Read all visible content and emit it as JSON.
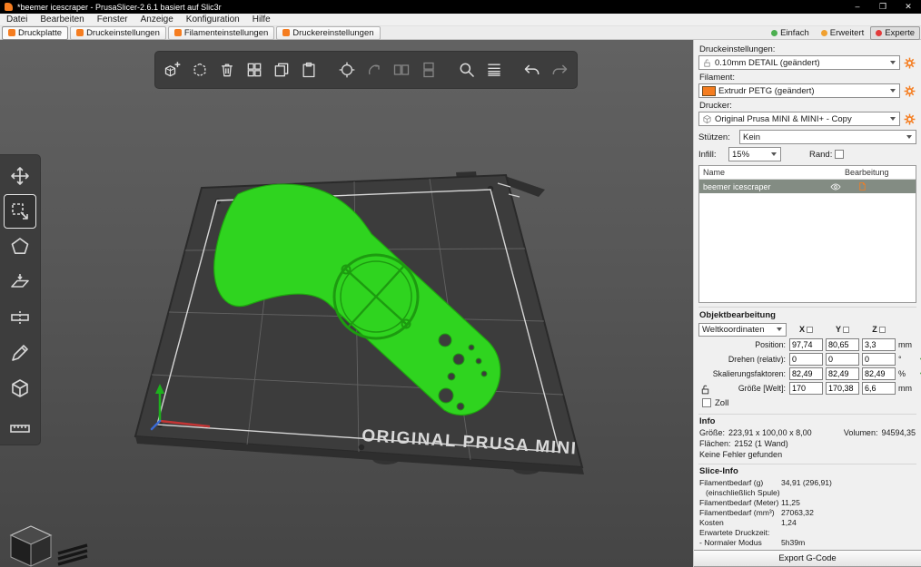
{
  "titlebar": {
    "title": "*beemer icescraper - PrusaSlicer-2.6.1 basiert auf Slic3r",
    "minimize": "–",
    "maximize": "❒",
    "close": "✕"
  },
  "menubar": {
    "items": [
      "Datei",
      "Bearbeiten",
      "Fenster",
      "Anzeige",
      "Konfiguration",
      "Hilfe"
    ]
  },
  "tabbar": {
    "tabs": [
      "Druckplatte",
      "Druckeinstellungen",
      "Filamenteinstellungen",
      "Druckereinstellungen"
    ],
    "modes": [
      {
        "label": "Einfach",
        "color": "#4caf50"
      },
      {
        "label": "Erweitert",
        "color": "#f0a030"
      },
      {
        "label": "Experte",
        "color": "#e23b3b"
      }
    ]
  },
  "toolbar_top": {
    "icons": [
      "add-object",
      "remove-object",
      "delete-all",
      "arrange",
      "copy",
      "paste",
      "instances",
      "reload-from-disk",
      "split-to-objects",
      "split-to-parts",
      "search",
      "variable-layer-height",
      "undo",
      "redo"
    ]
  },
  "toolbar_left": {
    "icons": [
      "move",
      "scale",
      "rotate",
      "place-on-face",
      "cut",
      "paint-supports",
      "seam",
      "measure"
    ]
  },
  "viewport": {
    "bed_text": "ORIGINAL PRUSA MINI"
  },
  "panel": {
    "print_settings_label": "Druckeinstellungen:",
    "print_settings_value": "0.10mm DETAIL (geändert)",
    "filament_label": "Filament:",
    "filament_value": "Extrudr PETG (geändert)",
    "filament_color": "#f57d20",
    "printer_label": "Drucker:",
    "printer_value": "Original Prusa MINI & MINI+ - Copy",
    "supports_label": "Stützen:",
    "supports_value": "Kein",
    "infill_label": "Infill:",
    "infill_value": "15%",
    "brim_label": "Rand:"
  },
  "object_list": {
    "col_name": "Name",
    "col_edit": "Bearbeitung",
    "rows": [
      {
        "name": "beemer icescraper",
        "selected": true
      }
    ]
  },
  "manipulation": {
    "title": "Objektbearbeitung",
    "coords": "Weltkoordinaten",
    "axis_x": "X",
    "axis_y": "Y",
    "axis_z": "Z",
    "rows": [
      {
        "label": "Position:",
        "v0": "97,74",
        "v1": "80,65",
        "v2": "3,3",
        "unit": "mm"
      },
      {
        "label": "Drehen (relativ):",
        "v0": "0",
        "v1": "0",
        "v2": "0",
        "unit": "°"
      },
      {
        "label": "Skalierungsfaktoren:",
        "v0": "82,49",
        "v1": "82,49",
        "v2": "82,49",
        "unit": "%"
      },
      {
        "label": "Größe [Welt]:",
        "v0": "170",
        "v1": "170,38",
        "v2": "6,6",
        "unit": "mm"
      }
    ],
    "inches_label": "Zoll"
  },
  "info": {
    "title": "Info",
    "size_label": "Größe:",
    "size_value": "223,91 x 100,00 x 8,00",
    "volume_label": "Volumen:",
    "volume_value": "94594,35",
    "faces_label": "Flächen:",
    "faces_value": "2152 (1 Wand)",
    "status": "Keine Fehler gefunden"
  },
  "slice_info": {
    "title": "Slice-Info",
    "rows": [
      {
        "label": "Filamentbedarf (g)",
        "value": "34,91 (296,91)"
      },
      {
        "label": "(einschließlich Spule)",
        "value": ""
      },
      {
        "label": "Filamentbedarf (Meter)",
        "value": "11,25"
      },
      {
        "label": "Filamentbedarf (mm³)",
        "value": "27063,32"
      },
      {
        "label": "Kosten",
        "value": "1,24"
      },
      {
        "label": "Erwartete Druckzeit:",
        "value": ""
      },
      {
        "label": "- Normaler Modus",
        "value": "5h39m"
      }
    ],
    "export_button": "Export G-Code"
  }
}
